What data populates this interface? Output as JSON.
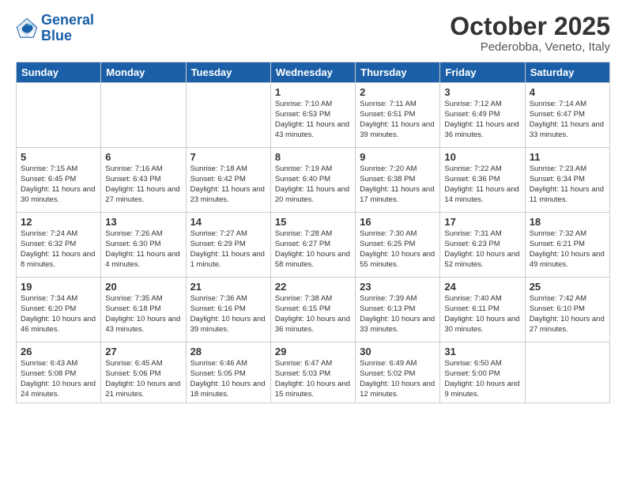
{
  "logo": {
    "line1": "General",
    "line2": "Blue"
  },
  "title": "October 2025",
  "location": "Pederobba, Veneto, Italy",
  "days_of_week": [
    "Sunday",
    "Monday",
    "Tuesday",
    "Wednesday",
    "Thursday",
    "Friday",
    "Saturday"
  ],
  "weeks": [
    [
      {
        "day": "",
        "info": ""
      },
      {
        "day": "",
        "info": ""
      },
      {
        "day": "",
        "info": ""
      },
      {
        "day": "1",
        "info": "Sunrise: 7:10 AM\nSunset: 6:53 PM\nDaylight: 11 hours\nand 43 minutes."
      },
      {
        "day": "2",
        "info": "Sunrise: 7:11 AM\nSunset: 6:51 PM\nDaylight: 11 hours\nand 39 minutes."
      },
      {
        "day": "3",
        "info": "Sunrise: 7:12 AM\nSunset: 6:49 PM\nDaylight: 11 hours\nand 36 minutes."
      },
      {
        "day": "4",
        "info": "Sunrise: 7:14 AM\nSunset: 6:47 PM\nDaylight: 11 hours\nand 33 minutes."
      }
    ],
    [
      {
        "day": "5",
        "info": "Sunrise: 7:15 AM\nSunset: 6:45 PM\nDaylight: 11 hours\nand 30 minutes."
      },
      {
        "day": "6",
        "info": "Sunrise: 7:16 AM\nSunset: 6:43 PM\nDaylight: 11 hours\nand 27 minutes."
      },
      {
        "day": "7",
        "info": "Sunrise: 7:18 AM\nSunset: 6:42 PM\nDaylight: 11 hours\nand 23 minutes."
      },
      {
        "day": "8",
        "info": "Sunrise: 7:19 AM\nSunset: 6:40 PM\nDaylight: 11 hours\nand 20 minutes."
      },
      {
        "day": "9",
        "info": "Sunrise: 7:20 AM\nSunset: 6:38 PM\nDaylight: 11 hours\nand 17 minutes."
      },
      {
        "day": "10",
        "info": "Sunrise: 7:22 AM\nSunset: 6:36 PM\nDaylight: 11 hours\nand 14 minutes."
      },
      {
        "day": "11",
        "info": "Sunrise: 7:23 AM\nSunset: 6:34 PM\nDaylight: 11 hours\nand 11 minutes."
      }
    ],
    [
      {
        "day": "12",
        "info": "Sunrise: 7:24 AM\nSunset: 6:32 PM\nDaylight: 11 hours\nand 8 minutes."
      },
      {
        "day": "13",
        "info": "Sunrise: 7:26 AM\nSunset: 6:30 PM\nDaylight: 11 hours\nand 4 minutes."
      },
      {
        "day": "14",
        "info": "Sunrise: 7:27 AM\nSunset: 6:29 PM\nDaylight: 11 hours\nand 1 minute."
      },
      {
        "day": "15",
        "info": "Sunrise: 7:28 AM\nSunset: 6:27 PM\nDaylight: 10 hours\nand 58 minutes."
      },
      {
        "day": "16",
        "info": "Sunrise: 7:30 AM\nSunset: 6:25 PM\nDaylight: 10 hours\nand 55 minutes."
      },
      {
        "day": "17",
        "info": "Sunrise: 7:31 AM\nSunset: 6:23 PM\nDaylight: 10 hours\nand 52 minutes."
      },
      {
        "day": "18",
        "info": "Sunrise: 7:32 AM\nSunset: 6:21 PM\nDaylight: 10 hours\nand 49 minutes."
      }
    ],
    [
      {
        "day": "19",
        "info": "Sunrise: 7:34 AM\nSunset: 6:20 PM\nDaylight: 10 hours\nand 46 minutes."
      },
      {
        "day": "20",
        "info": "Sunrise: 7:35 AM\nSunset: 6:18 PM\nDaylight: 10 hours\nand 43 minutes."
      },
      {
        "day": "21",
        "info": "Sunrise: 7:36 AM\nSunset: 6:16 PM\nDaylight: 10 hours\nand 39 minutes."
      },
      {
        "day": "22",
        "info": "Sunrise: 7:38 AM\nSunset: 6:15 PM\nDaylight: 10 hours\nand 36 minutes."
      },
      {
        "day": "23",
        "info": "Sunrise: 7:39 AM\nSunset: 6:13 PM\nDaylight: 10 hours\nand 33 minutes."
      },
      {
        "day": "24",
        "info": "Sunrise: 7:40 AM\nSunset: 6:11 PM\nDaylight: 10 hours\nand 30 minutes."
      },
      {
        "day": "25",
        "info": "Sunrise: 7:42 AM\nSunset: 6:10 PM\nDaylight: 10 hours\nand 27 minutes."
      }
    ],
    [
      {
        "day": "26",
        "info": "Sunrise: 6:43 AM\nSunset: 5:08 PM\nDaylight: 10 hours\nand 24 minutes."
      },
      {
        "day": "27",
        "info": "Sunrise: 6:45 AM\nSunset: 5:06 PM\nDaylight: 10 hours\nand 21 minutes."
      },
      {
        "day": "28",
        "info": "Sunrise: 6:46 AM\nSunset: 5:05 PM\nDaylight: 10 hours\nand 18 minutes."
      },
      {
        "day": "29",
        "info": "Sunrise: 6:47 AM\nSunset: 5:03 PM\nDaylight: 10 hours\nand 15 minutes."
      },
      {
        "day": "30",
        "info": "Sunrise: 6:49 AM\nSunset: 5:02 PM\nDaylight: 10 hours\nand 12 minutes."
      },
      {
        "day": "31",
        "info": "Sunrise: 6:50 AM\nSunset: 5:00 PM\nDaylight: 10 hours\nand 9 minutes."
      },
      {
        "day": "",
        "info": ""
      }
    ]
  ]
}
